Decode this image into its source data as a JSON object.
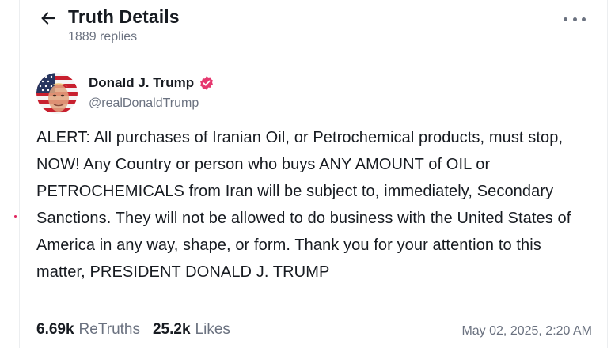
{
  "header": {
    "title": "Truth Details",
    "replies": "1889 replies"
  },
  "post": {
    "author_name": "Donald J. Trump",
    "handle": "@realDonaldTrump",
    "text": "ALERT: All purchases of Iranian Oil, or Petrochemical products, must stop, NOW! Any Country or person who buys ANY AMOUNT of OIL or PETROCHEMICALS from Iran will be subject to, immediately, Secondary Sanctions. They will not be allowed to do business with the United States of America in any way, shape, or form. Thank you for your attention to this matter, PRESIDENT DONALD J. TRUMP",
    "retruths_count": "6.69k",
    "retruths_label": "ReTruths",
    "likes_count": "25.2k",
    "likes_label": "Likes",
    "timestamp": "May 02, 2025, 2:20 AM"
  },
  "icons": {
    "back": "arrow-left-icon",
    "more": "more-horizontal-icon",
    "verified": "verified-badge-icon"
  },
  "colors": {
    "verified_badge": "#e6386f",
    "muted_text": "#6b7280",
    "primary_text": "#171b21"
  }
}
